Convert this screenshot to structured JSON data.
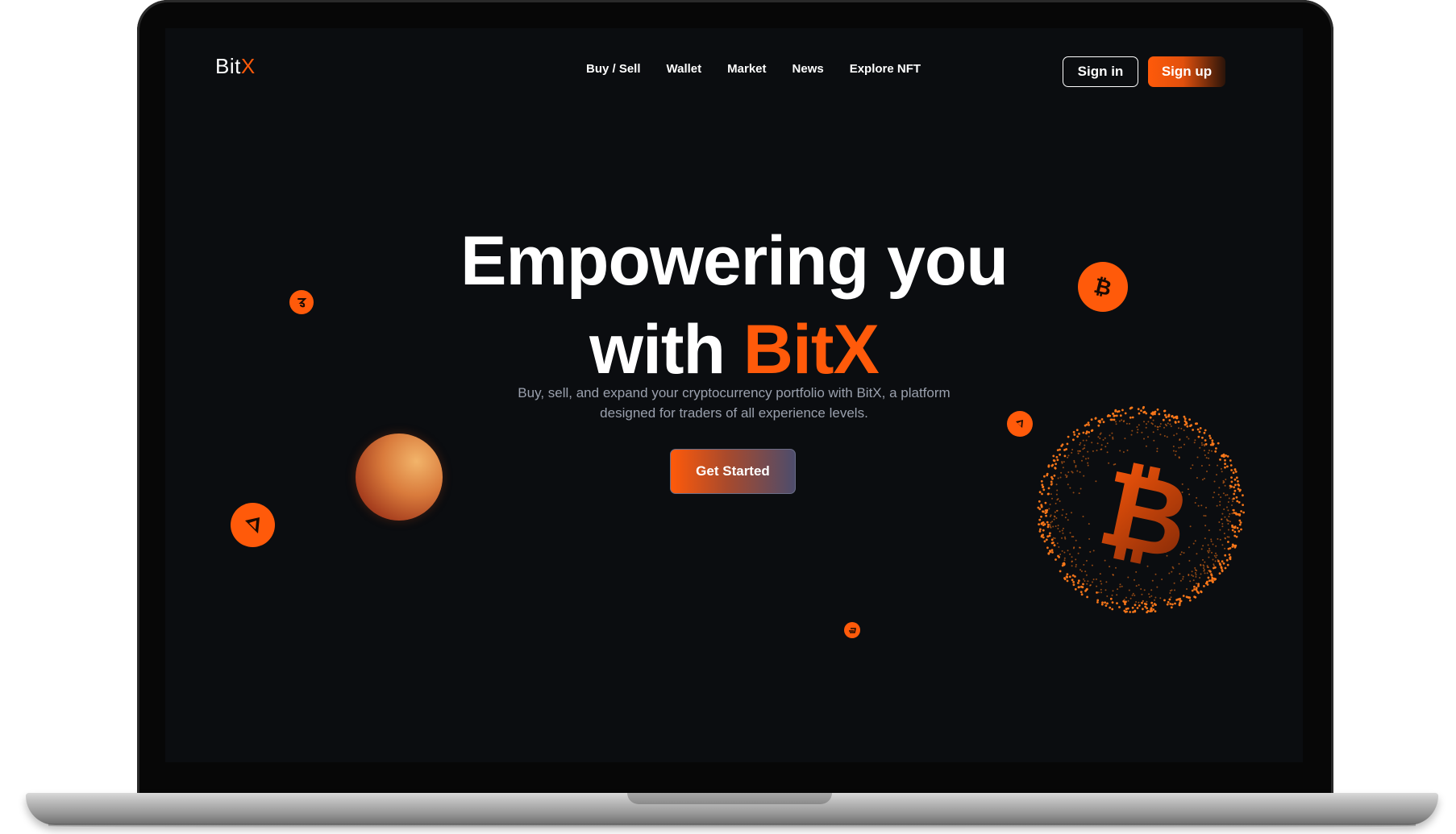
{
  "logo": {
    "main": "Bit",
    "accent": "X"
  },
  "nav": {
    "items": [
      "Buy / Sell",
      "Wallet",
      "Market",
      "News",
      "Explore NFT"
    ]
  },
  "auth": {
    "signin": "Sign in",
    "signup": "Sign up"
  },
  "hero": {
    "line1": "Empowering you",
    "line2_main": "with ",
    "line2_accent": "BitX",
    "subtitle_line1": "Buy, sell, and expand your cryptocurrency portfolio with BitX, a platform",
    "subtitle_line2": "designed for traders of all experience levels.",
    "cta": "Get Started"
  },
  "colors": {
    "accent": "#ff5a0a",
    "background": "#0b0d10",
    "muted_text": "#9aa0ad"
  },
  "icons": [
    "tezos-coin-icon",
    "bitcoin-coin-icon",
    "ethereum-coin-icon",
    "dash-coin-icon",
    "bitcoin-globe-icon"
  ]
}
